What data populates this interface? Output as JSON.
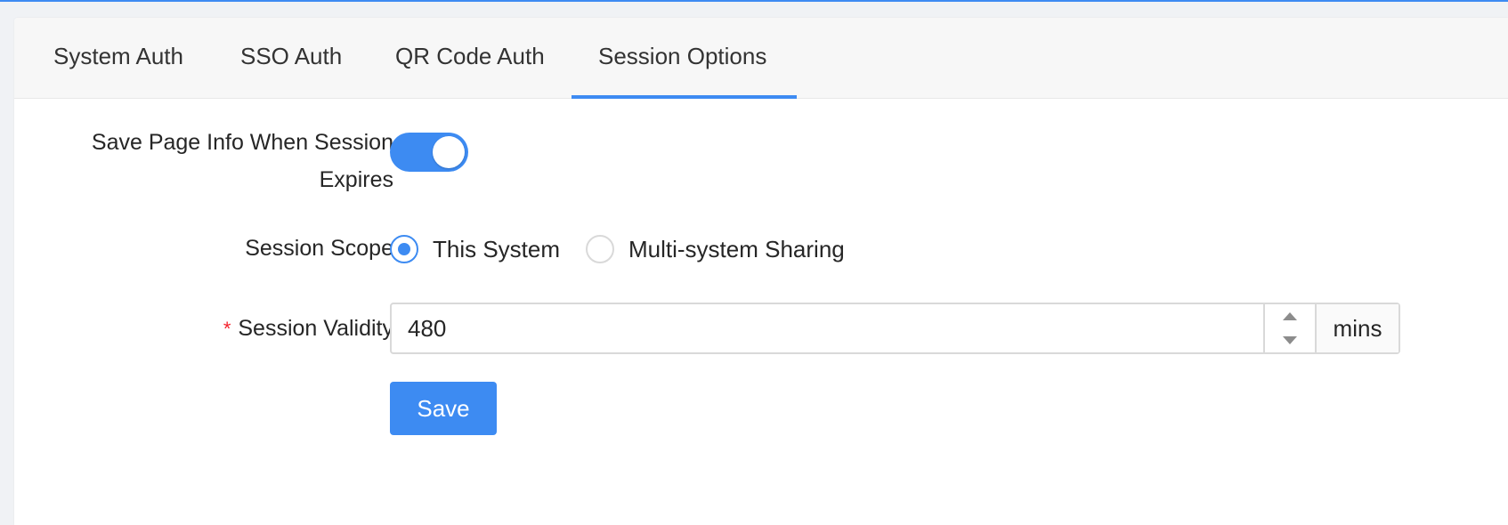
{
  "tabs": [
    {
      "label": "System Auth"
    },
    {
      "label": "SSO Auth"
    },
    {
      "label": "QR Code Auth"
    },
    {
      "label": "Session Options"
    }
  ],
  "active_tab": "Session Options",
  "form": {
    "save_page_info": {
      "label_line1": "Save Page Info When Session",
      "label_line2": "Expires",
      "enabled": true
    },
    "session_scope": {
      "label": "Session Scope",
      "options": [
        {
          "label": "This System",
          "checked": true
        },
        {
          "label": "Multi-system Sharing",
          "checked": false
        }
      ]
    },
    "session_validity": {
      "required_mark": "*",
      "label": "Session Validity",
      "value": "480",
      "unit": "mins"
    },
    "save_label": "Save"
  },
  "colors": {
    "accent": "#3d8bf2",
    "required": "#f5222d"
  }
}
